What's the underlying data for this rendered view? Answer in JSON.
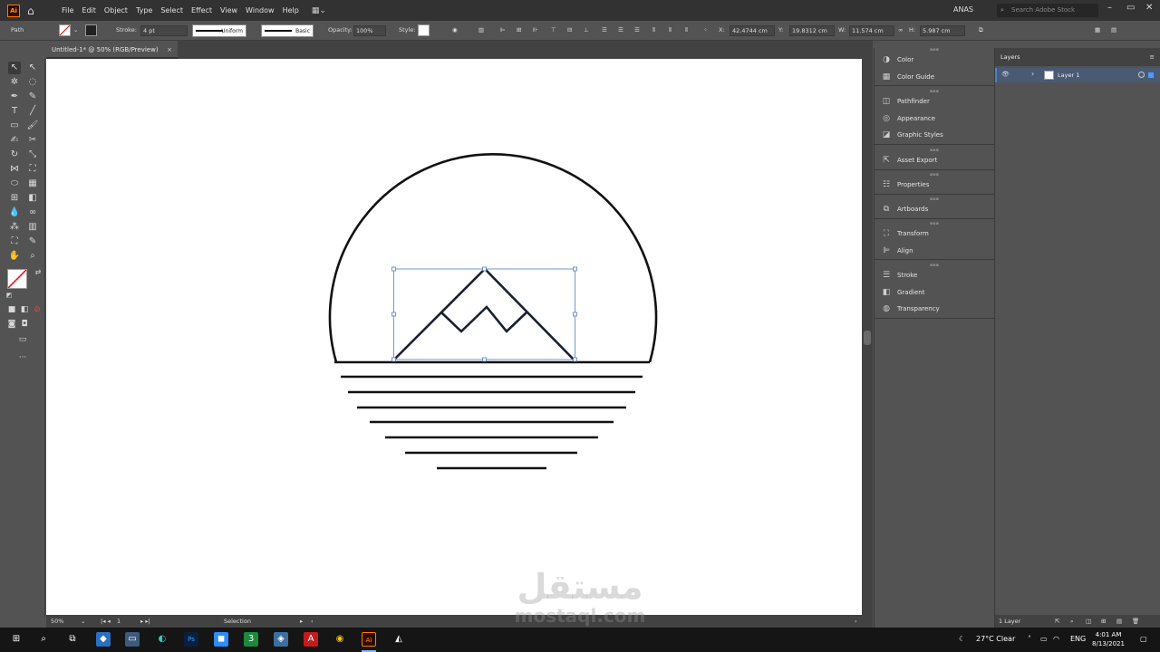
{
  "menubar": {
    "app_badge": "Ai",
    "items": [
      "File",
      "Edit",
      "Object",
      "Type",
      "Select",
      "Effect",
      "View",
      "Window",
      "Help"
    ],
    "user": "ANAS",
    "search_placeholder": "Search Adobe Stock"
  },
  "controlbar": {
    "selection_type": "Path",
    "stroke_label": "Stroke:",
    "stroke_weight": "4 pt",
    "stroke_profile": "Uniform",
    "brush": "Basic",
    "opacity_label": "Opacity:",
    "opacity": "100%",
    "style_label": "Style:",
    "x_label": "X:",
    "x": "42.4744 cm",
    "y_label": "Y:",
    "y": "19.8312 cm",
    "w_label": "W:",
    "w": "11.574 cm",
    "h_label": "H:",
    "h": "5.987 cm"
  },
  "document": {
    "tab_title": "Untitled-1* @ 50% (RGB/Preview)",
    "close": "×"
  },
  "statusbar": {
    "zoom": "50%",
    "artboard": "1",
    "tool": "Selection"
  },
  "panels": {
    "groups": [
      [
        "Color",
        "Color Guide"
      ],
      [
        "Pathfinder",
        "Appearance",
        "Graphic Styles"
      ],
      [
        "Asset Export"
      ],
      [
        "Properties"
      ],
      [
        "Artboards"
      ],
      [
        "Transform",
        "Align"
      ],
      [
        "Stroke",
        "Gradient",
        "Transparency"
      ]
    ]
  },
  "layers": {
    "title": "Layers",
    "layer_name": "Layer 1",
    "footer": "1 Layer"
  },
  "taskbar": {
    "weather": "27°C  Clear",
    "lang": "ENG",
    "time": "4:01 AM",
    "date": "8/13/2021"
  },
  "watermark": {
    "arabic": "مستقل",
    "latin": "mostaql.com"
  },
  "colors": {
    "artwork_stroke": "#111111",
    "selection": "#4a7fc1",
    "ui_bg": "#535353",
    "ui_dark": "#323232"
  }
}
